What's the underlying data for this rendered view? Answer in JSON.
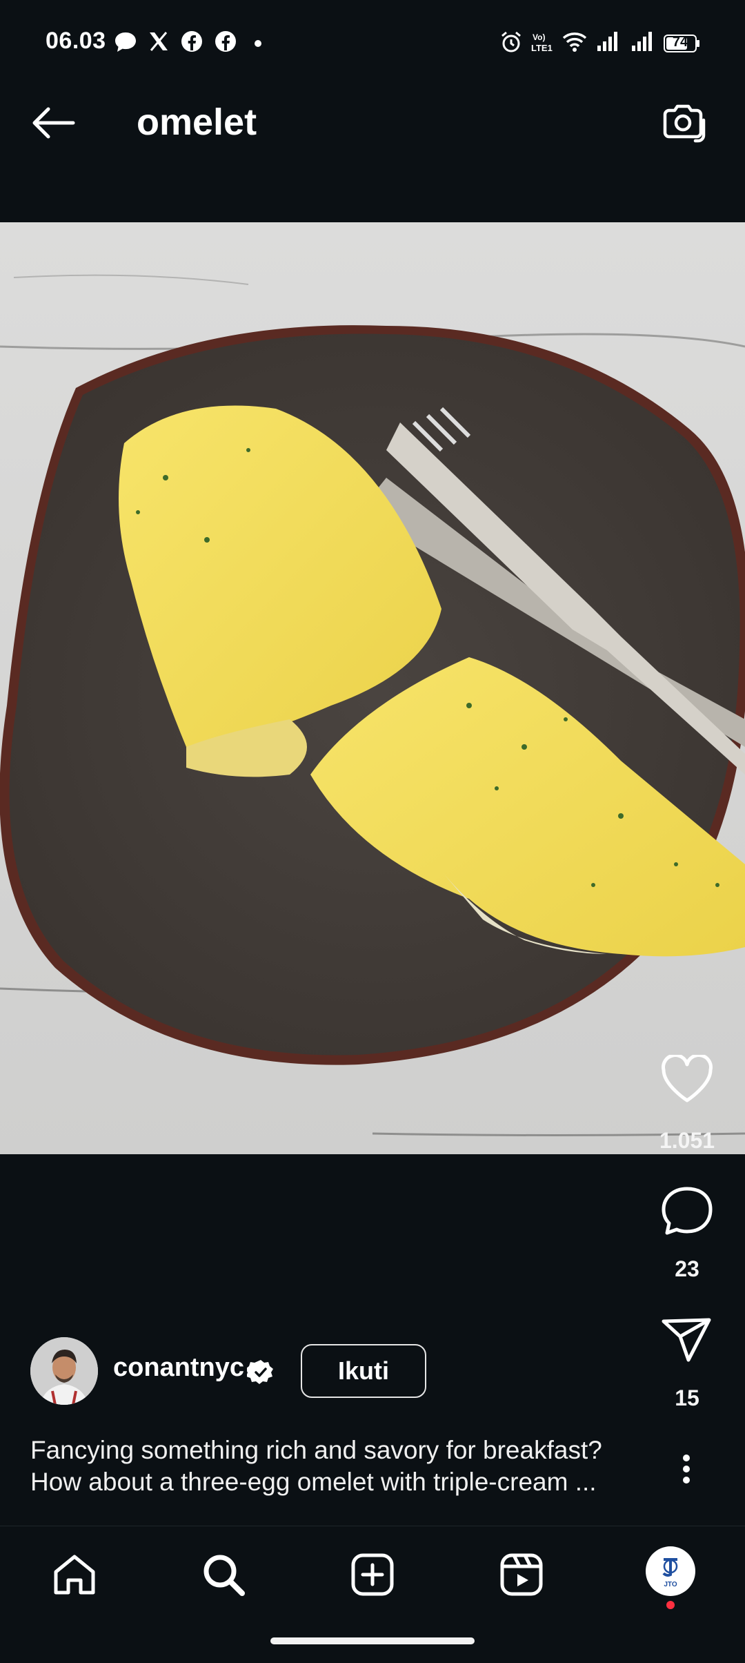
{
  "status_bar": {
    "time": "06.03",
    "battery": "74"
  },
  "header": {
    "title": "omelet"
  },
  "actions": {
    "likes": "1.051",
    "comments": "23",
    "shares": "15"
  },
  "post": {
    "username": "conantnyc",
    "follow_label": "Ikuti",
    "caption_line1": "Fancying something rich and savory for breakfast?",
    "caption_line2": "How about a three-egg omelet with triple-cream ..."
  },
  "profile_badge": {
    "text": "JTO"
  },
  "colors": {
    "background": "#0b1014",
    "verified": "#ffffff",
    "notification_dot": "#ff3040"
  }
}
